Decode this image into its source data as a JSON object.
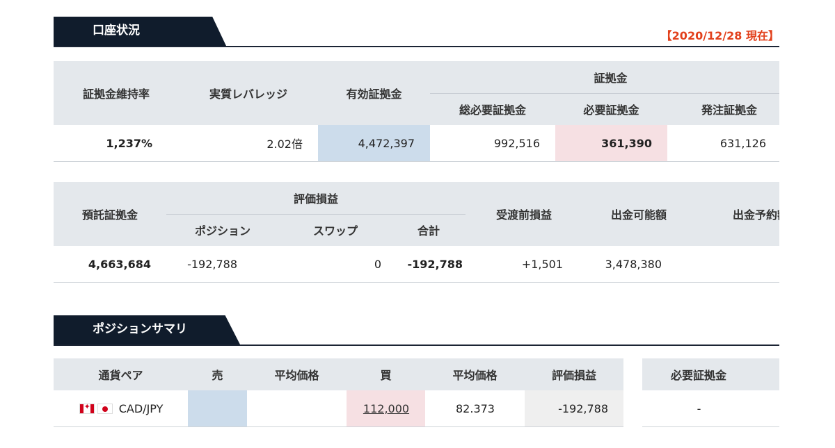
{
  "account": {
    "title": "口座状況",
    "as_of": "【2020/12/28 現在】",
    "margin_table": {
      "headers": {
        "maintenance_rate": "証拠金維持率",
        "leverage": "実質レバレッジ",
        "effective_margin": "有効証拠金",
        "margin_group": "証拠金",
        "total_required": "総必要証拠金",
        "required": "必要証拠金",
        "order_margin": "発注証拠金"
      },
      "values": {
        "maintenance_rate": "1,237%",
        "leverage": "2.02倍",
        "effective_margin": "4,472,397",
        "total_required": "992,516",
        "required": "361,390",
        "order_margin": "631,126"
      }
    },
    "deposit_table": {
      "headers": {
        "deposit": "預託証拠金",
        "pl_group": "評価損益",
        "position": "ポジション",
        "swap": "スワップ",
        "total": "合計",
        "unsettled": "受渡前損益",
        "withdrawable": "出金可能額",
        "withdraw_reserved": "出金予約額"
      },
      "values": {
        "deposit": "4,663,684",
        "position": "-192,788",
        "swap": "0",
        "total": "-192,788",
        "unsettled": "+1,501",
        "withdrawable": "3,478,380",
        "withdraw_reserved": ""
      }
    }
  },
  "positions": {
    "title": "ポジションサマリ",
    "headers": {
      "pair": "通貨ペア",
      "sell": "売",
      "sell_avg": "平均価格",
      "buy": "買",
      "buy_avg": "平均価格",
      "pl": "評価損益",
      "required_margin": "必要証拠金"
    },
    "rows": [
      {
        "pair": "CAD/JPY",
        "flags": [
          "canada-flag-icon",
          "japan-flag-icon"
        ],
        "sell": "",
        "sell_avg": "",
        "buy": "112,000",
        "buy_avg": "82.373",
        "pl": "-192,788",
        "required_margin": "-"
      }
    ]
  },
  "colors": {
    "navy": "#101c2c",
    "accent_red": "#e2401b",
    "blue_cell": "#ccdceb",
    "pink_cell": "#f6e0e3"
  }
}
